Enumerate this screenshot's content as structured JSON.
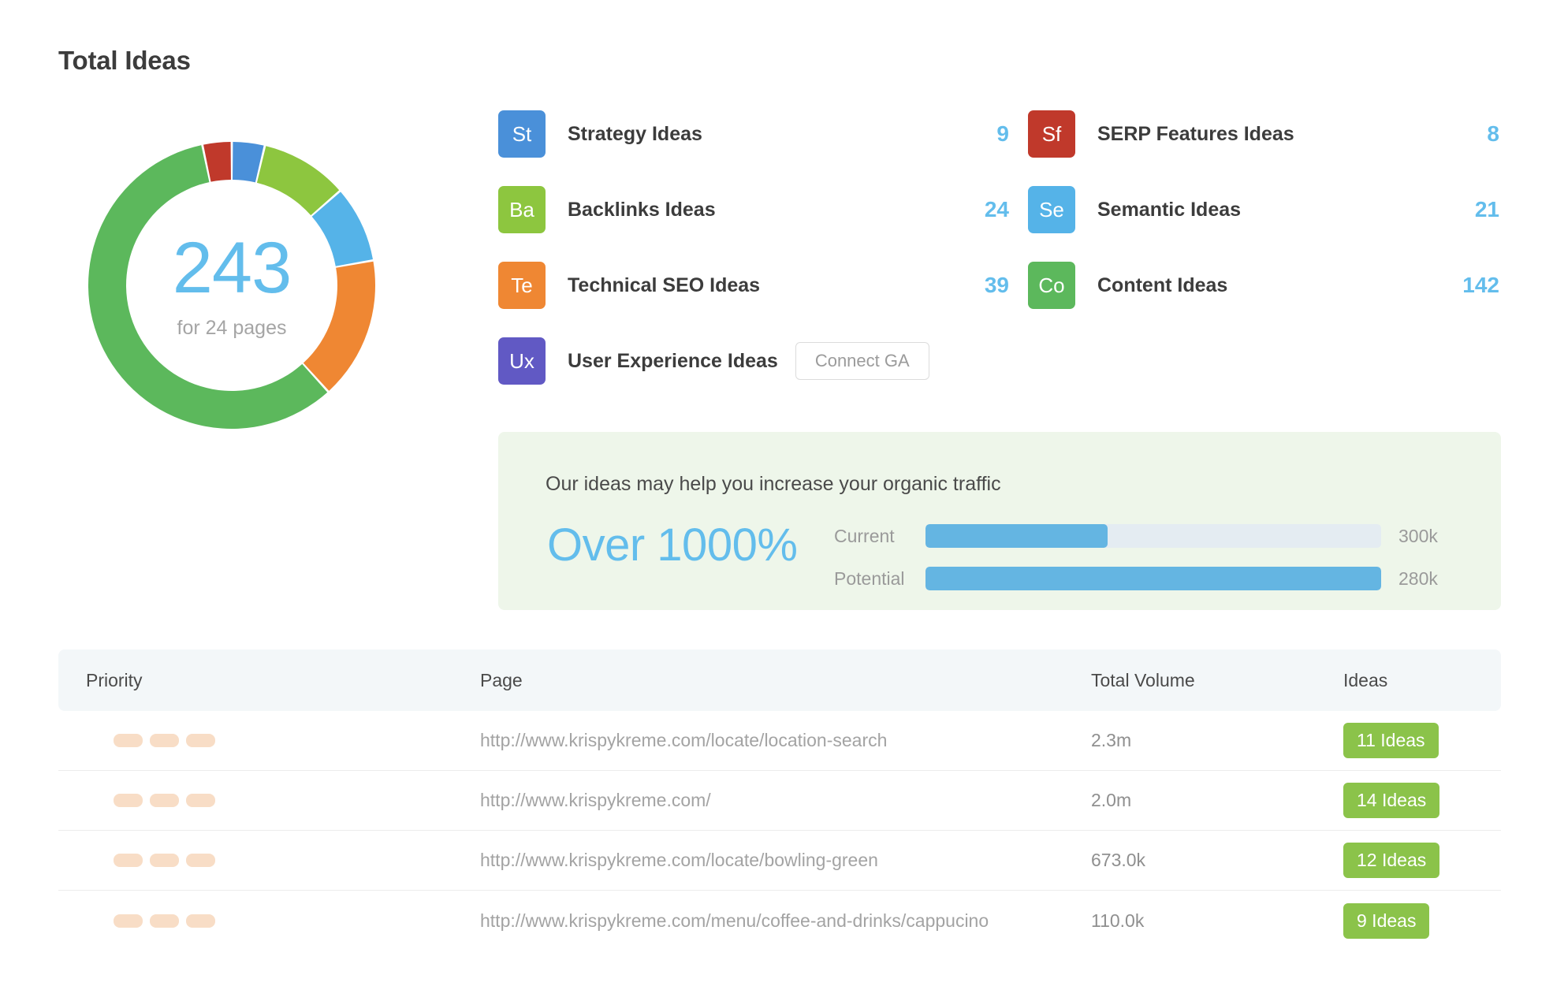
{
  "header": {
    "title": "Total Ideas"
  },
  "donut": {
    "value": "243",
    "subtitle": "for 24 pages"
  },
  "chart_data": {
    "type": "pie",
    "title": "Total Ideas",
    "total": 243,
    "center_label": "243",
    "center_sublabel": "for 24 pages",
    "legend_position": "right",
    "categories": [
      "Strategy Ideas",
      "Backlinks Ideas",
      "Semantic Ideas",
      "Technical SEO Ideas",
      "Content Ideas",
      "SERP Features Ideas"
    ],
    "values": [
      9,
      24,
      21,
      39,
      142,
      8
    ],
    "colors": [
      "#4a90d9",
      "#8dc63f",
      "#55b3e8",
      "#ef8733",
      "#5cb85c",
      "#c0392b"
    ]
  },
  "legend": {
    "left": [
      {
        "abbr": "St",
        "label": "Strategy Ideas",
        "value": "9",
        "color": "#4a90d9"
      },
      {
        "abbr": "Ba",
        "label": "Backlinks Ideas",
        "value": "24",
        "color": "#8dc63f"
      },
      {
        "abbr": "Te",
        "label": "Technical SEO Ideas",
        "value": "39",
        "color": "#ef8733"
      },
      {
        "abbr": "Ux",
        "label": "User Experience Ideas",
        "value": "",
        "color": "#6159c4",
        "button": "Connect GA"
      }
    ],
    "right": [
      {
        "abbr": "Sf",
        "label": "SERP Features Ideas",
        "value": "8",
        "color": "#c0392b"
      },
      {
        "abbr": "Se",
        "label": "Semantic Ideas",
        "value": "21",
        "color": "#55b3e8"
      },
      {
        "abbr": "Co",
        "label": "Content Ideas",
        "value": "142",
        "color": "#5cb85c"
      }
    ]
  },
  "traffic": {
    "title": "Our ideas may help you increase your organic traffic",
    "percent": "Over 1000%",
    "bars": [
      {
        "label": "Current",
        "value": "300k",
        "fill_pct": 40
      },
      {
        "label": "Potential",
        "value": "280k",
        "fill_pct": 100
      }
    ]
  },
  "table": {
    "columns": [
      "Priority",
      "Page",
      "Total Volume",
      "Ideas"
    ],
    "rows": [
      {
        "priority": 3,
        "page": "http://www.krispykreme.com/locate/location-search",
        "volume": "2.3m",
        "ideas": "11 Ideas"
      },
      {
        "priority": 3,
        "page": "http://www.krispykreme.com/",
        "volume": "2.0m",
        "ideas": "14 Ideas"
      },
      {
        "priority": 3,
        "page": "http://www.krispykreme.com/locate/bowling-green",
        "volume": "673.0k",
        "ideas": "12 Ideas"
      },
      {
        "priority": 3,
        "page": "http://www.krispykreme.com/menu/coffee-and-drinks/cappucino",
        "volume": "110.0k",
        "ideas": "9 Ideas"
      }
    ]
  }
}
